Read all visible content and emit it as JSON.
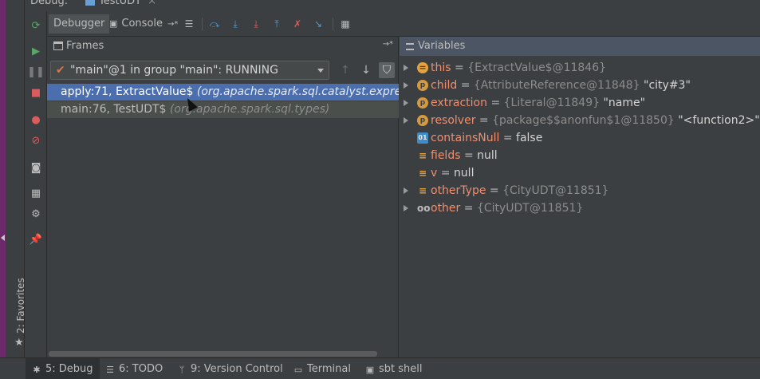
{
  "header": {
    "title": "Debug:",
    "tab_label": "TestUDT",
    "tab_close": "×"
  },
  "top_toolbar": {
    "tabs": [
      {
        "label": "Debugger"
      },
      {
        "label": "Console"
      }
    ],
    "console_pin": "→*"
  },
  "frames": {
    "header_label": "Frames",
    "thread": "\"main\"@1 in group \"main\": RUNNING",
    "items": [
      {
        "method": "apply:71, ExtractValue$",
        "package": "(org.apache.spark.sql.catalyst.expressions)"
      },
      {
        "method": "main:76, TestUDT$",
        "package": "(org.apache.spark.sql.types)"
      }
    ]
  },
  "variables": {
    "header_label": "Variables",
    "items": [
      {
        "name": "this",
        "eq": "=",
        "type": "{ExtractValue$@11846}",
        "value": ""
      },
      {
        "name": "child",
        "eq": "=",
        "type": "{AttributeReference@11848}",
        "value": "\"city#3\""
      },
      {
        "name": "extraction",
        "eq": "=",
        "type": "{Literal@11849}",
        "value": "\"name\""
      },
      {
        "name": "resolver",
        "eq": "=",
        "type": "{package$$anonfun$1@11850}",
        "value": "\"<function2>\""
      },
      {
        "name": "containsNull",
        "eq": "=",
        "type": "",
        "value": "false"
      },
      {
        "name": "fields",
        "eq": "=",
        "type": "",
        "value": "null"
      },
      {
        "name": "v",
        "eq": "=",
        "type": "",
        "value": "null"
      },
      {
        "name": "otherType",
        "eq": "=",
        "type": "{CityUDT@11851}",
        "value": ""
      },
      {
        "name": "other",
        "eq": "=",
        "type": "{CityUDT@11851}",
        "value": ""
      }
    ]
  },
  "sidebar": {
    "favorites_label": "2: Favorites"
  },
  "bottom_tabs": [
    {
      "label": "5: Debug"
    },
    {
      "label": "6: TODO"
    },
    {
      "label": "9: Version Control"
    },
    {
      "label": "Terminal"
    },
    {
      "label": "sbt shell"
    }
  ],
  "colors": {
    "accent": "#4b6eaf",
    "var_name": "#f08d6e",
    "rerun": "#59a869",
    "stop": "#db5c5c"
  }
}
